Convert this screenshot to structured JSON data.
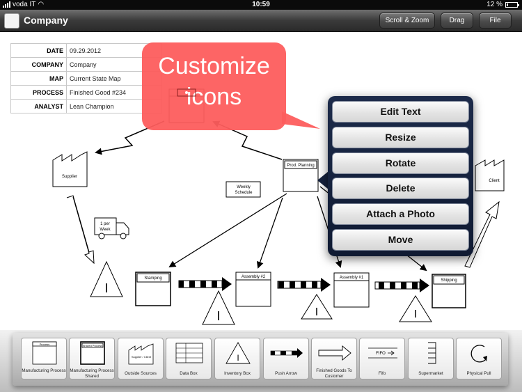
{
  "status_bar": {
    "carrier": "voda IT",
    "time": "10:59",
    "battery": "12 %"
  },
  "nav": {
    "title": "Company",
    "buttons": [
      "Scroll & Zoom",
      "Drag",
      "File"
    ]
  },
  "data_box": [
    {
      "label": "DATE",
      "value": "09.29.2012"
    },
    {
      "label": "COMPANY",
      "value": "Company"
    },
    {
      "label": "MAP",
      "value": "Current State Map"
    },
    {
      "label": "PROCESS",
      "value": "Finished Good #234"
    },
    {
      "label": "ANALYST",
      "value": "Lean Champion"
    }
  ],
  "callout": {
    "line1": "Customize",
    "line2": "icons"
  },
  "context_menu": [
    "Edit Text",
    "Resize",
    "Rotate",
    "Delete",
    "Attach a Photo",
    "Move"
  ],
  "diagram": {
    "supplier": "Supplier",
    "client": "Client",
    "prod_planning": "Prod. Planning",
    "weekly_schedule": [
      "Weekly",
      "Schedule"
    ],
    "truck_label": [
      "1 per",
      "Week"
    ],
    "processes": [
      "Stamping",
      "Assembly #2",
      "Assembly #1",
      "Shipping"
    ],
    "inventory_symbol": "I"
  },
  "palette": [
    {
      "label": "Manufacturing Process",
      "inner": "Process",
      "icon": "manufacturing-process-icon"
    },
    {
      "label": "Manufacturing Process Shared",
      "inner": "Shared Process",
      "icon": "shared-process-icon"
    },
    {
      "label": "Outside Sources",
      "inner": "Supplier / Client",
      "icon": "factory-icon"
    },
    {
      "label": "Data Box",
      "inner": "",
      "icon": "data-box-icon"
    },
    {
      "label": "Inventory Box",
      "inner": "I",
      "icon": "inventory-triangle-icon"
    },
    {
      "label": "Push Arrow",
      "inner": "",
      "icon": "push-arrow-icon"
    },
    {
      "label": "Finished Goods To Customer",
      "inner": "",
      "icon": "hollow-arrow-icon"
    },
    {
      "label": "Fifo",
      "inner": "FIFO",
      "icon": "fifo-icon"
    },
    {
      "label": "Supermarket",
      "inner": "",
      "icon": "supermarket-icon"
    },
    {
      "label": "Physical Pull",
      "inner": "",
      "icon": "pull-circle-icon"
    }
  ]
}
